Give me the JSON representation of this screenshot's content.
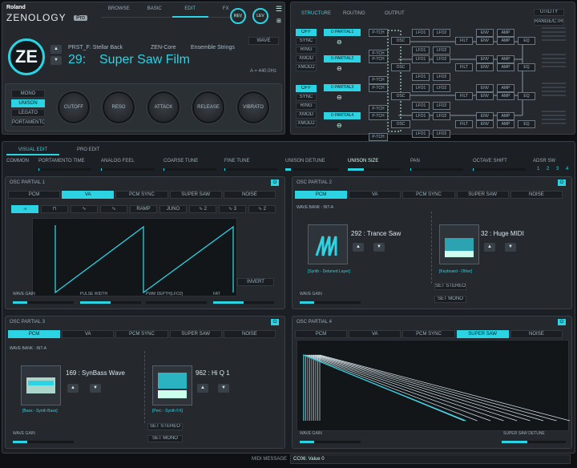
{
  "brand": {
    "roland": "Roland",
    "product": "ZENOLOGY",
    "edition": "Pro"
  },
  "top_tabs": [
    "BROWSE",
    "BASIC",
    "EDIT",
    "FX"
  ],
  "top_right": {
    "rev": "REV",
    "lev": "LEV",
    "menu": "☰",
    "unknown": "⊞"
  },
  "patch": {
    "category": "PRST_F: Stellar Back",
    "engine": "ZEN-Core",
    "tag": "Ensemble Strings",
    "number": "29:",
    "name": "Super Saw Film",
    "wave_btn": "WAVE",
    "tuning": "A = 440.0Hz"
  },
  "mode_buttons": [
    "MONO",
    "UNISON",
    "LEGATO",
    "PORTAMENTO"
  ],
  "knobs": [
    "CUTOFF",
    "RESO",
    "ATTACK",
    "RELEASE",
    "VIBRATO"
  ],
  "structure": {
    "tabs": [
      "STRUCTURE",
      "ROUTING",
      "OUTPUT"
    ],
    "utility": "UTILITY",
    "range": "RANGE/CTRL",
    "ring": [
      "OFF",
      "SYNC",
      "RING",
      "XMOD",
      "XMOD2"
    ],
    "partials": [
      "PARTIAL1",
      "PARTIAL2",
      "PARTIAL3",
      "PARTIAL4"
    ],
    "blocks": {
      "ptch": "P-TCH",
      "osc": "OSC",
      "lfo1": "LFO1",
      "lfo2": "LFO2",
      "filt": "FILT",
      "env": "ENV",
      "amp": "AMP",
      "eq": "EQ"
    }
  },
  "edit_tabs": {
    "visual": "VISUAL EDIT",
    "pro": "PRO EDIT"
  },
  "common": {
    "label": "COMMON",
    "params": [
      "PORTAMENTO TIME",
      "ANALOG FEEL",
      "COARSE TUNE",
      "FINE TUNE",
      "UNISON DETUNE",
      "UNISON SIZE",
      "PAN",
      "OCTAVE SHIFT"
    ],
    "adsr": "ADSR SW",
    "adsr_nums": [
      "1",
      "2",
      "3",
      "4"
    ]
  },
  "osc1": {
    "title": "OSC PARTIAL 1",
    "tabs": [
      "PCM",
      "VA",
      "PCM SYNC",
      "SUPER SAW",
      "NOISE"
    ],
    "active": 1,
    "waves": [
      "⩘",
      "⊓",
      "∿",
      "∿",
      "RAMP",
      "JUNO",
      "∿ 2",
      "∿ 3",
      "∿ 2"
    ],
    "invert": "INVERT",
    "params": [
      "WAVE GAIN",
      "PULSE WIDTH",
      "PWM DEPTH(LFO2)",
      "FAT"
    ]
  },
  "osc2": {
    "title": "OSC PARTIAL 2",
    "tabs": [
      "PCM",
      "VA",
      "PCM SYNC",
      "SUPER SAW",
      "NOISE"
    ],
    "active": 0,
    "bank": "WAVE BANK : INT-A",
    "waveA": "292 : Trance Saw",
    "waveA_cat": "[Synth - Detuned Layer]",
    "waveB": "32 : Huge MIDI",
    "waveB_cat": "[Keyboard - Other]",
    "set_stereo": "SET STEREO",
    "set_mono": "SET MONO",
    "gain": "WAVE GAIN"
  },
  "osc3": {
    "title": "OSC PARTIAL 3",
    "tabs": [
      "PCM",
      "VA",
      "PCM SYNC",
      "SUPER SAW",
      "NOISE"
    ],
    "active": 0,
    "bank": "WAVE BANK : INT-A",
    "waveA": "169 : SynBass Wave",
    "waveA_cat": "[Bass - Synth Bass]",
    "waveB": "962 : Hi Q 1",
    "waveB_cat": "[Perc - Synth FX]",
    "set_stereo": "SET STEREO",
    "set_mono": "SET MONO",
    "gain": "WAVE GAIN"
  },
  "osc4": {
    "title": "OSC PARTIAL 4",
    "tabs": [
      "PCM",
      "VA",
      "PCM SYNC",
      "SUPER SAW",
      "NOISE"
    ],
    "active": 3,
    "gain": "WAVE GAIN",
    "detune": "SUPER SAW DETUNE"
  },
  "status": {
    "label": "MIDI MESSAGE",
    "value": "CC06: Value 0"
  },
  "colors": {
    "accent": "#2bd3e3",
    "panel": "#25292e",
    "bg": "#0e1013"
  }
}
